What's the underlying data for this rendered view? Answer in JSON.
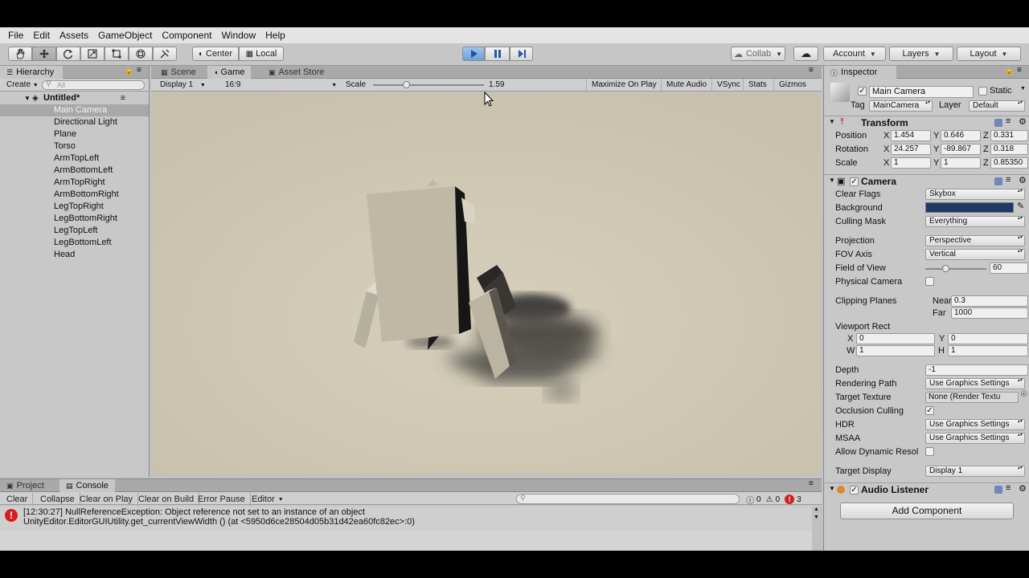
{
  "menu": [
    "File",
    "Edit",
    "Assets",
    "GameObject",
    "Component",
    "Window",
    "Help"
  ],
  "toolbar": {
    "pivot": "Center",
    "space": "Local",
    "collab": "Collab",
    "account": "Account",
    "layers": "Layers",
    "layout": "Layout"
  },
  "hierarchy": {
    "tab": "Hierarchy",
    "create": "Create",
    "search_placeholder": "All",
    "scene": "Untitled*",
    "items": [
      "Main Camera",
      "Directional Light",
      "Plane",
      "Torso",
      "ArmTopLeft",
      "ArmBottomLeft",
      "ArmTopRight",
      "ArmBottomRight",
      "LegTopRight",
      "LegBottomRight",
      "LegTopLeft",
      "LegBottomLeft",
      "Head"
    ],
    "selected_index": 0
  },
  "game_view": {
    "tabs": [
      "Scene",
      "Game",
      "Asset Store"
    ],
    "active_tab": "Game",
    "display": "Display 1",
    "aspect": "16:9",
    "scale_label": "Scale",
    "scale_value": "1.59",
    "scale_fraction": 0.3,
    "maximize": "Maximize On Play",
    "mute": "Mute Audio",
    "vsync": "VSync",
    "stats": "Stats",
    "gizmos": "Gizmos"
  },
  "inspector": {
    "tab": "Inspector",
    "object_name": "Main Camera",
    "static_label": "Static",
    "tag_label": "Tag",
    "tag_value": "MainCamera",
    "layer_label": "Layer",
    "layer_value": "Default",
    "transform": {
      "title": "Transform",
      "position_label": "Position",
      "position": {
        "x": "1.454",
        "y": "0.646",
        "z": "0.331"
      },
      "rotation_label": "Rotation",
      "rotation": {
        "x": "24.257",
        "y": "-89.867",
        "z": "0.318"
      },
      "scale_label": "Scale",
      "scale": {
        "x": "1",
        "y": "1",
        "z": "0.85350"
      }
    },
    "camera": {
      "title": "Camera",
      "clear_flags_label": "Clear Flags",
      "clear_flags": "Skybox",
      "background_label": "Background",
      "background_color": "#1d3a66",
      "culling_mask_label": "Culling Mask",
      "culling_mask": "Everything",
      "projection_label": "Projection",
      "projection": "Perspective",
      "fov_axis_label": "FOV Axis",
      "fov_axis": "Vertical",
      "fov_label": "Field of View",
      "fov": "60",
      "fov_fraction": 0.33,
      "physical_label": "Physical Camera",
      "clipping_label": "Clipping Planes",
      "near_label": "Near",
      "near": "0.3",
      "far_label": "Far",
      "far": "1000",
      "viewport_label": "Viewport Rect",
      "vx_label": "X",
      "vx": "0",
      "vy_label": "Y",
      "vy": "0",
      "vw_label": "W",
      "vw": "1",
      "vh_label": "H",
      "vh": "1",
      "depth_label": "Depth",
      "depth": "-1",
      "rendering_path_label": "Rendering Path",
      "rendering_path": "Use Graphics Settings",
      "target_texture_label": "Target Texture",
      "target_texture": "None (Render Textu",
      "occlusion_label": "Occlusion Culling",
      "hdr_label": "HDR",
      "hdr": "Use Graphics Settings",
      "msaa_label": "MSAA",
      "msaa": "Use Graphics Settings",
      "dynamic_label": "Allow Dynamic Resol",
      "target_display_label": "Target Display",
      "target_display": "Display 1"
    },
    "audio_listener": "Audio Listener",
    "add_component": "Add Component"
  },
  "bottom": {
    "tabs": [
      "Project",
      "Console"
    ],
    "active_tab": "Console",
    "buttons": [
      "Clear",
      "Collapse",
      "Clear on Play",
      "Clear on Build",
      "Error Pause",
      "Editor"
    ],
    "count_info": "0",
    "count_warn": "0",
    "count_error": "3",
    "log_line1": "[12:30:27] NullReferenceException: Object reference not set to an instance of an object",
    "log_line2": "UnityEditor.EditorGUIUtility.get_currentViewWidth () (at <5950d6ce28504d05b31d42ea60fc82ec>:0)"
  }
}
